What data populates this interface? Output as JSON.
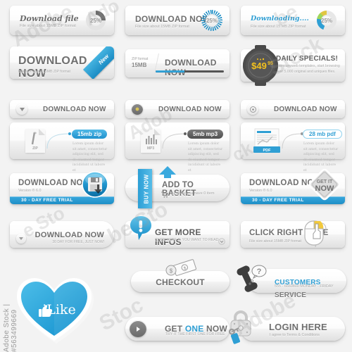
{
  "sheet": {
    "watermark": "Adobe Stock",
    "stock_code": "Adobe Stock | #563499669",
    "accent_blue": "#2f9fd4",
    "accent_dark": "#5a5a5a",
    "accent_yellow": "#f2c01e"
  },
  "row1": {
    "card1": {
      "title": "Download file",
      "subtitle": "File size about 15MB ZIP format",
      "percent": "25%",
      "ring_style": "solid-dark"
    },
    "card2": {
      "title": "DOWNLOAD NOW",
      "subtitle": "File size about 15MB ZIP format",
      "percent": "25%",
      "ring_style": "segmented-blue"
    },
    "card3": {
      "title": "Downloading....",
      "subtitle": "File size about 15 MB ZIP format",
      "percent": "25%",
      "ring_style": "multicolor"
    }
  },
  "row2": {
    "card1": {
      "title": "DOWNLOAD NOW",
      "subtitle": "File size about 15MB ZIP format",
      "ribbon": "New",
      "icon": "double-chevron-down-icon"
    },
    "card2": {
      "title": "DOWNLOAD NOW",
      "format_label": "ZIP format",
      "format_size": "15MB",
      "progress_percent": 42
    },
    "card3": {
      "title": "DAILY SPECIALS!",
      "body": "Premium web templates, start browsing over 5.000 original and uniques files.",
      "price_main": "$49",
      "price_cents": "95"
    }
  },
  "row3": {
    "buttons": [
      {
        "label": "DOWNLOAD NOW",
        "icon": "caret-down-icon"
      },
      {
        "label": "DOWNLOAD NOW",
        "icon": "dot-circle-icon"
      },
      {
        "label": "DOWNLOAD NOW",
        "icon": "target-icon"
      }
    ]
  },
  "row4": {
    "panels": [
      {
        "tag": "15mb zip",
        "tag_style": "blue",
        "file_type": "ZIP",
        "body": "Lorem ipsum dolor sit amet, consectetur adipiscing elit, sed do eiusmod tempor incididunt ut labore et"
      },
      {
        "tag": "5mb mp3",
        "tag_style": "dark",
        "file_type": "MP3",
        "body": "Lorem ipsum dolor sit amet, consectetur adipiscing elit, sed do eiusmod tempor incididunt ut labore et"
      },
      {
        "tag": "28 mb pdf",
        "tag_style": "ghost",
        "file_type": "PDF",
        "body": "Lorem ipsum dolor sit amet, consectetur adipiscing elit, sed do eiusmod tempor incididunt ut labore et"
      }
    ]
  },
  "row5": {
    "card1": {
      "title": "DOWNLOAD NOW",
      "subtitle": "Version ® 6.0",
      "bar": "30 - DAY FREE TRIAL",
      "icon": "floppy-disk-download-icon"
    },
    "card2": {
      "title": "ADD TO BASKET",
      "subtitle": "currently you have 0 item",
      "ribbon": "BUY NOW",
      "icon": "shopping-cart-icon"
    },
    "card3": {
      "title": "DOWNLOAD NOW",
      "subtitle": "Version ® 6.0",
      "bar": "30 - DAY FREE TRIAL",
      "badge_line1": "GET IT",
      "badge_line2": "NOW"
    }
  },
  "row6": {
    "card1": {
      "title": "DOWNLOAD NOW",
      "subtitle": "30 DAY FOR FREE, JUST NOW!",
      "icon": "caret-down-icon"
    },
    "card2": {
      "title": "GET MORE INFOS",
      "subtitle": "CLICK HERE IF YOU WANT TO READ",
      "icon": "exclamation-bubble-icon",
      "corner_icon": "chevron-down-circle-icon"
    },
    "card3": {
      "title": "CLICK RIGHT HERE",
      "subtitle": "File size about 15MB ZIP format",
      "icon": "mouse-right-click-icon"
    }
  },
  "row7": {
    "checkout": {
      "title": "CHECKOUT",
      "icon": "money-coin-icon"
    },
    "service": {
      "title_accent": "CUSTOMERS",
      "title_rest": "SERVICE",
      "subtitle": "555 - 6660800 MONDAY - FRIDAY",
      "icon": "phone-question-icon"
    }
  },
  "row8": {
    "get_one": {
      "title_pre": "GET ",
      "title_accent": "ONE",
      "title_post": " NOW",
      "subtitle": "TRY IT  THE FIRST ONE FOR FREE",
      "icon": "arrow-right-circle-icon"
    },
    "login": {
      "title": "LOGIN HERE",
      "subtitle": "I agree to Terms & Conditions",
      "icon": "padlock-key-icon"
    }
  },
  "heart": {
    "label": "iLike",
    "icon": "thumbs-up-icon"
  }
}
